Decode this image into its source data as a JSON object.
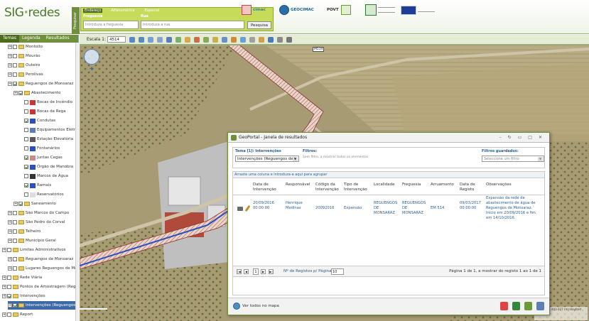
{
  "header": {
    "logo_sig": "SIG",
    "logo_redes": "redes",
    "search_side_label": "Pesquisar",
    "search_tabs": [
      "Endereço",
      "Alfanumérica",
      "Espacial"
    ],
    "label_freguesia": "Freguesia",
    "label_rua": "Rua",
    "placeholder_freguesia": "Introduza a freguesia",
    "placeholder_rua": "Introduza a rua",
    "search_button": "Pesquisa",
    "partner_cimac": "cimac",
    "partner_geo": "GEOCIMAC",
    "partner_povt": "POVT"
  },
  "left": {
    "tabs": [
      "Temas",
      "Legenda",
      "Resultados"
    ],
    "tree": [
      {
        "label": "Montoito",
        "indent": 1
      },
      {
        "label": "Mourão",
        "indent": 1
      },
      {
        "label": "Outeiro",
        "indent": 1
      },
      {
        "label": "Perolivas",
        "indent": 1
      },
      {
        "label": "Reguengos de Monsaraz",
        "indent": 1
      },
      {
        "label": "Abastecimento",
        "indent": 2
      },
      {
        "label": "Bocas de Incêndio",
        "indent": 3
      },
      {
        "label": "Bocas de Rega",
        "indent": 3
      },
      {
        "label": "Condutas",
        "indent": 3
      },
      {
        "label": "Equipamentos Elétricos",
        "indent": 3
      },
      {
        "label": "Estação Elevatória",
        "indent": 3
      },
      {
        "label": "Fontanários",
        "indent": 3
      },
      {
        "label": "Juntas Cegas",
        "indent": 3
      },
      {
        "label": "Órgão de Manobra",
        "indent": 3
      },
      {
        "label": "Marcos de Água",
        "indent": 3
      },
      {
        "label": "Ramais",
        "indent": 3
      },
      {
        "label": "Reservatórios",
        "indent": 3
      },
      {
        "label": "Saneamento",
        "indent": 2
      },
      {
        "label": "São Marcos do Campo",
        "indent": 1
      },
      {
        "label": "São Pedro do Corval",
        "indent": 1
      },
      {
        "label": "Telheiro",
        "indent": 1
      },
      {
        "label": "Município Geral",
        "indent": 1
      },
      {
        "label": "Limites Administrativos",
        "indent": 0
      },
      {
        "label": "Reguengos de Monsaraz",
        "indent": 1
      },
      {
        "label": "Lugares Reguengos de Monsaraz",
        "indent": 1
      },
      {
        "label": "Rede Viária",
        "indent": 0
      },
      {
        "label": "Pontos de Amostragem (Regiões)",
        "indent": 0
      },
      {
        "label": "Intervenções",
        "indent": 0
      },
      {
        "label": "Intervenções (Reguengos)",
        "indent": 1
      },
      {
        "label": "Report",
        "indent": 0
      }
    ]
  },
  "map": {
    "scale_label": "Escala 1:",
    "scale_value": "4514",
    "road_label": "M514",
    "coords_text": "125.944 -4.403.027 (m) Hayford Gauss"
  },
  "results": {
    "title": "GeoPortal - Janela de resultados",
    "tema_label": "Tema [1]: Intervenções",
    "tema_value": "Intervenções (Reguengos de",
    "filtros_label": "Filtros:",
    "filtros_text": "Sem filtro, a mostrar todos os elementos",
    "filtros_guardados_label": "Filtros guardados:",
    "filtros_guardados_value": "Seleccione um filtro",
    "group_hint": "Arraste uma coluna e introduza-a aqui para agrupar",
    "columns": [
      "Data de Intervenção",
      "Responsável",
      "Código da Intervenção",
      "Tipo de Intervenção",
      "Localidade",
      "Freguesia",
      "Arruamento",
      "Data de Registo",
      "Observações"
    ],
    "row": {
      "data_intervencao": "20/09/2016 00:00:00",
      "responsavel": "Henrique Medinas",
      "codigo": "20092016",
      "tipo": "Expansão",
      "localidade": "REGUENGOS DE MONSARAZ",
      "freguesia": "REGUENGOS DE MONSARAZ",
      "arruamento": "EM 514",
      "data_registo": "09/03/2017 00:00:00",
      "observacoes": "Expansão da rede de abastecimento de água de Reguengos de Monsaraz. Início em 20/09/2016 e fim em 14/10/2016."
    },
    "page_number": "1",
    "per_page_label": "Nº de Registos p/ Página:",
    "per_page_value": "10",
    "page_status": "Página 1 de 1, a mostrar do registo 1 ao 1 de 1",
    "view_all": "Ver todos no mapa"
  }
}
